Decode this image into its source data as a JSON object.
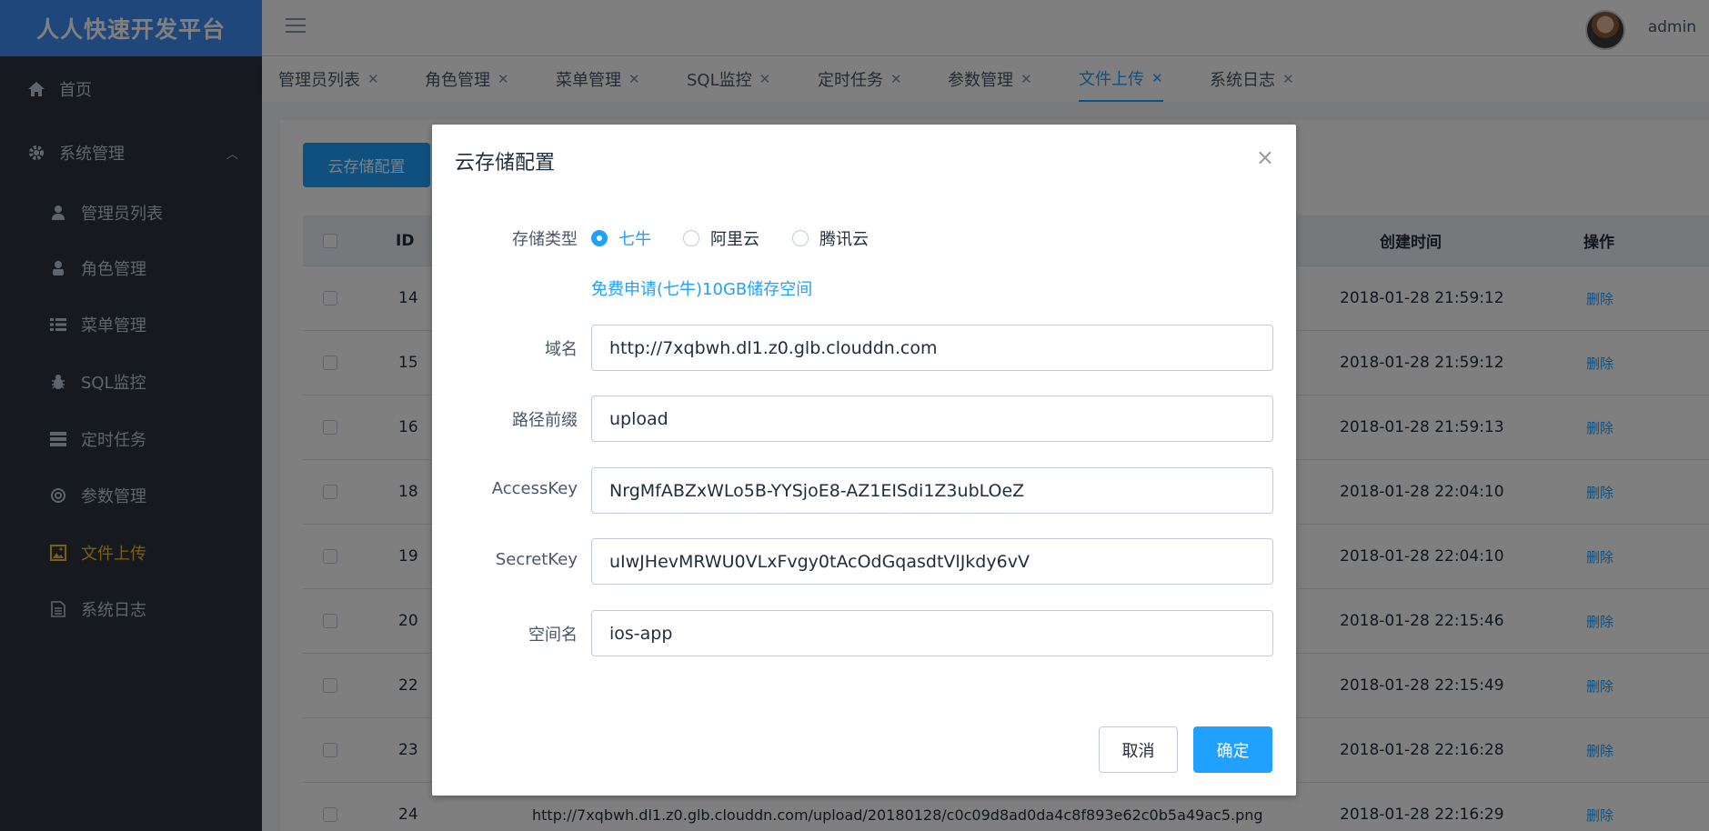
{
  "app": {
    "title": "人人快速开发平台",
    "username": "admin"
  },
  "sidebar": {
    "home": "首页",
    "system": "系统管理",
    "items": [
      {
        "label": "管理员列表",
        "icon": "user-icon"
      },
      {
        "label": "角色管理",
        "icon": "role-icon"
      },
      {
        "label": "菜单管理",
        "icon": "list-icon"
      },
      {
        "label": "SQL监控",
        "icon": "bug-icon"
      },
      {
        "label": "定时任务",
        "icon": "tasks-icon"
      },
      {
        "label": "参数管理",
        "icon": "gear-icon"
      },
      {
        "label": "文件上传",
        "icon": "image-icon",
        "active": true
      },
      {
        "label": "系统日志",
        "icon": "document-icon"
      }
    ]
  },
  "tabs": [
    {
      "label": "管理员列表"
    },
    {
      "label": "角色管理"
    },
    {
      "label": "菜单管理"
    },
    {
      "label": "SQL监控"
    },
    {
      "label": "定时任务"
    },
    {
      "label": "参数管理"
    },
    {
      "label": "文件上传",
      "active": true
    },
    {
      "label": "系统日志"
    }
  ],
  "main": {
    "config_button": "云存储配置",
    "table": {
      "headers": {
        "id": "ID",
        "created": "创建时间",
        "ops": "操作"
      },
      "rows": [
        {
          "id": "14",
          "url": "",
          "created": "2018-01-28 21:59:12",
          "op": "删除"
        },
        {
          "id": "15",
          "url": "",
          "created": "2018-01-28 21:59:12",
          "op": "删除"
        },
        {
          "id": "16",
          "url": "",
          "created": "2018-01-28 21:59:13",
          "op": "删除"
        },
        {
          "id": "18",
          "url": "",
          "created": "2018-01-28 22:04:10",
          "op": "删除"
        },
        {
          "id": "19",
          "url": "",
          "created": "2018-01-28 22:04:10",
          "op": "删除"
        },
        {
          "id": "20",
          "url": "",
          "created": "2018-01-28 22:15:46",
          "op": "删除"
        },
        {
          "id": "22",
          "url": "",
          "created": "2018-01-28 22:15:49",
          "op": "删除"
        },
        {
          "id": "23",
          "url": "",
          "created": "2018-01-28 22:16:28",
          "op": "删除"
        },
        {
          "id": "24",
          "url": "http://7xqbwh.dl1.z0.glb.clouddn.com/upload/20180128/c0c09d8ad0da4c8f893e62c0b5a49ac5.png",
          "created": "2018-01-28 22:16:29",
          "op": "删除"
        }
      ]
    }
  },
  "dialog": {
    "title": "云存储配置",
    "close": "×",
    "storage_type_label": "存储类型",
    "radios": [
      {
        "label": "七牛",
        "checked": true
      },
      {
        "label": "阿里云",
        "checked": false
      },
      {
        "label": "腾讯云",
        "checked": false
      }
    ],
    "free_link": "免费申请(七牛)10GB储存空间",
    "fields": {
      "domain": {
        "label": "域名",
        "value": "http://7xqbwh.dl1.z0.glb.clouddn.com"
      },
      "prefix": {
        "label": "路径前缀",
        "value": "upload"
      },
      "access_key": {
        "label": "AccessKey",
        "value": "NrgMfABZxWLo5B-YYSjoE8-AZ1EISdi1Z3ubLOeZ"
      },
      "secret_key": {
        "label": "SecretKey",
        "value": "uIwJHevMRWU0VLxFvgy0tAcOdGqasdtVlJkdy6vV"
      },
      "bucket": {
        "label": "空间名",
        "value": "ios-app"
      }
    },
    "cancel": "取消",
    "confirm": "确定"
  }
}
